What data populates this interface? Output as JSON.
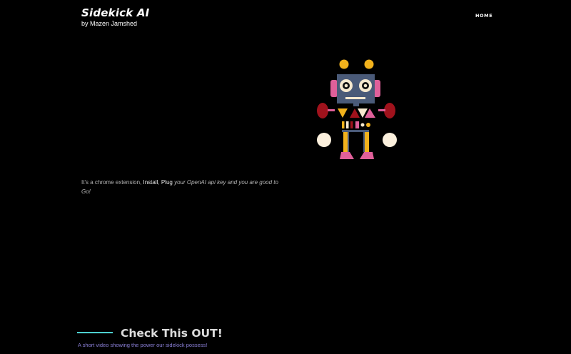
{
  "header": {
    "brand_title": "Sidekick AI",
    "brand_subtitle": "by Mazen Jamshed",
    "nav_home": "HOME"
  },
  "hero": {
    "intro_prefix": "It's a chrome extension, ",
    "intro_install": "Install",
    "intro_comma": ", ",
    "intro_plug": "Plug",
    "intro_rest": " your OpenAI api key and you are good to Go!"
  },
  "video_section": {
    "title": "Check This OUT!",
    "subtitle": "A short video showing the power our sidekick possess!"
  },
  "colors": {
    "background": "#000000",
    "accent_rule": "#4dd0d0",
    "subtitle_text": "#8a7fd6"
  }
}
